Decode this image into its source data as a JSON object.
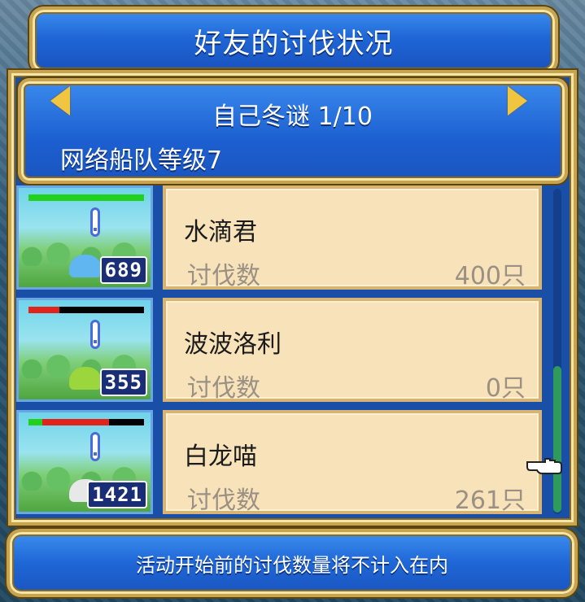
{
  "window": {
    "title": "好友的讨伐状况"
  },
  "header": {
    "player_name": "自己冬谜 1/10",
    "fleet_level": "网络船队等级7"
  },
  "monsters": [
    {
      "name": "水滴君",
      "kill_label": "讨伐数",
      "kill_value": "400只",
      "count": "689",
      "hp_ratio": 1.0,
      "hp_color": "#22d11b",
      "color": "#5fb6f0"
    },
    {
      "name": "波波洛利",
      "kill_label": "讨伐数",
      "kill_value": "0只",
      "count": "355",
      "hp_ratio": 0.27,
      "hp_color": "#e0241c",
      "color": "#9ad63c"
    },
    {
      "name": "白龙喵",
      "kill_label": "讨伐数",
      "kill_value": "261只",
      "count": "1421",
      "hp_ratio_green": 0.12,
      "hp_ratio_red": 0.58,
      "hp_color": "#e0241c",
      "color": "#e8e8e8"
    }
  ],
  "footer": {
    "notice": "活动开始前的讨伐数量将不计入在内"
  },
  "icons": {
    "prev": "left-arrow-icon",
    "next": "right-arrow-icon",
    "pointer": "pointing-hand-icon"
  },
  "colors": {
    "panel_blue": "#1c5fd0",
    "card_bg": "#f7e2b9",
    "gold": "#f2c540"
  }
}
